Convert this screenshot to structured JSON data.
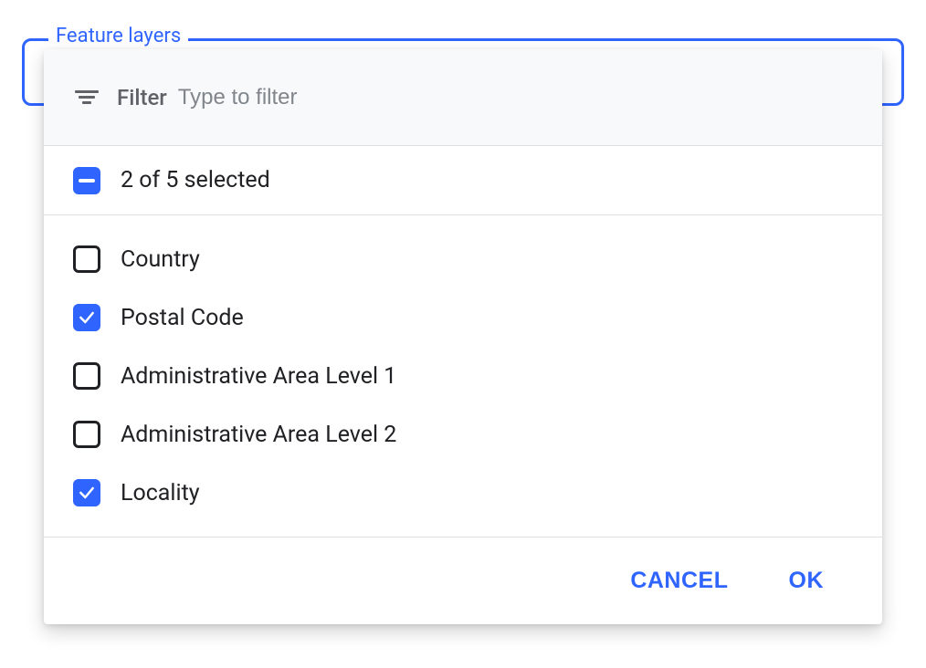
{
  "field": {
    "legend": "Feature layers"
  },
  "filter": {
    "label": "Filter",
    "placeholder": "Type to filter",
    "value": ""
  },
  "selectAll": {
    "state": "indeterminate",
    "summary": "2 of 5 selected"
  },
  "options": [
    {
      "label": "Country",
      "checked": false
    },
    {
      "label": "Postal Code",
      "checked": true
    },
    {
      "label": "Administrative Area Level 1",
      "checked": false
    },
    {
      "label": "Administrative Area Level 2",
      "checked": false
    },
    {
      "label": "Locality",
      "checked": true
    }
  ],
  "actions": {
    "cancel": "CANCEL",
    "ok": "OK"
  }
}
